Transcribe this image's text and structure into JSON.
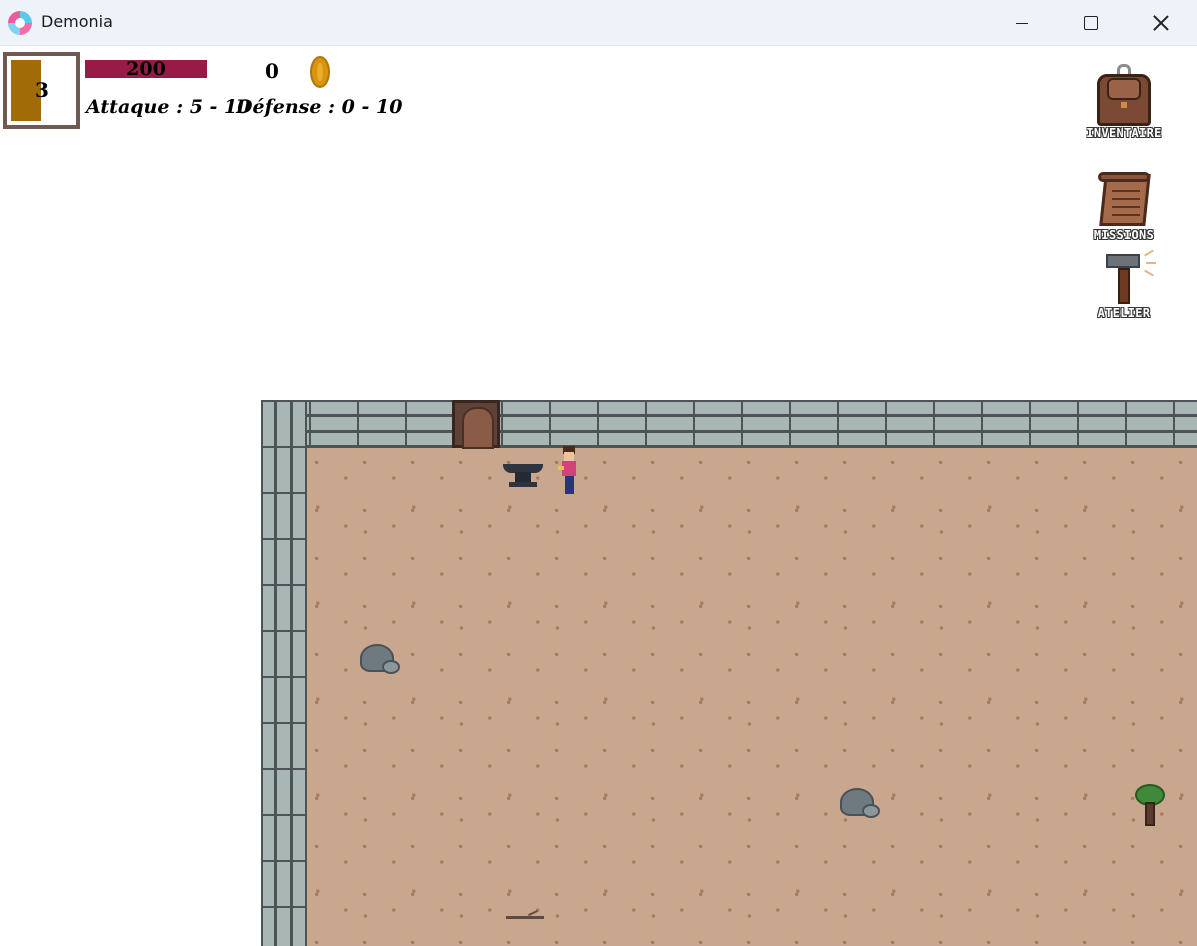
{
  "window": {
    "title": "Demonia",
    "minimize_label": "",
    "maximize_label": "",
    "close_label": ""
  },
  "hud": {
    "level": "3",
    "health": "200",
    "gold": "0",
    "attack": "Attaque : 5 - 10",
    "defense": "Défense : 0 - 10",
    "health_bar_color": "#9a1a47",
    "level_fill_color": "#a16c07",
    "coin_icon": "gold-coin-icon"
  },
  "menu": {
    "inventory_label": "INVENTAIRE",
    "inventory_icon": "backpack-icon",
    "missions_label": "MISSIONS",
    "missions_icon": "scroll-icon",
    "workshop_label": "ATELIER",
    "workshop_icon": "hammer-icon"
  },
  "world": {
    "floor_color": "#c9a68e",
    "wall_color": "#a9b7b4",
    "objects": [
      "door",
      "anvil",
      "player",
      "rock",
      "rock",
      "tree",
      "stick"
    ]
  }
}
